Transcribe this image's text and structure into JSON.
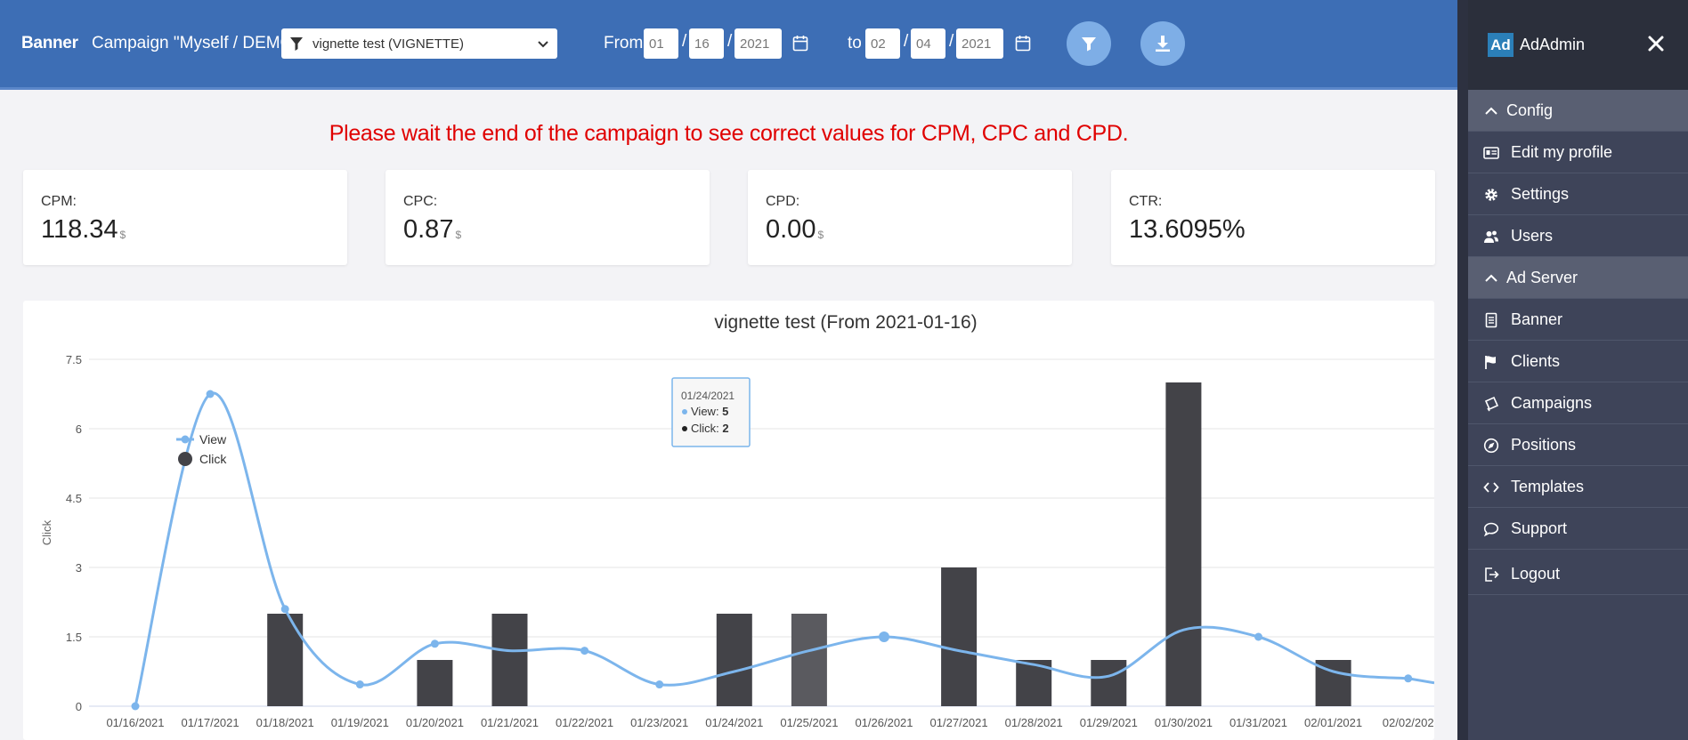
{
  "topbar": {
    "title": "Banner",
    "campaign_label": "Campaign \"Myself / DEMO\":",
    "campaign_value": "vignette test (VIGNETTE)",
    "from_label": "From",
    "from_month": "01",
    "from_day": "16",
    "from_year": "2021",
    "to_label": "to",
    "to_month": "02",
    "to_day": "04",
    "to_year": "2021",
    "date_separator": "/",
    "icons": [
      "filter-icon",
      "chevron-down-icon",
      "calendar-icon",
      "download-icon"
    ]
  },
  "notice": "Please wait the end of the campaign to see correct values for CPM, CPC and CPD.",
  "stats": [
    {
      "label": "CPM:",
      "value": "118.34",
      "unit": "$"
    },
    {
      "label": "CPC:",
      "value": "0.87",
      "unit": "$"
    },
    {
      "label": "CPD:",
      "value": "0.00",
      "unit": "$"
    },
    {
      "label": "CTR:",
      "value": "13.6095%",
      "unit": ""
    }
  ],
  "chart_data": {
    "type": "bar",
    "title": "vignette test (From 2021-01-16)",
    "xlabel": "",
    "ylabel": "Click",
    "ylim": [
      0,
      7.5
    ],
    "yticks": [
      "0",
      "1.5",
      "3",
      "4.5",
      "6",
      "7.5"
    ],
    "grid": true,
    "legend_position": "top-left",
    "categories": [
      "01/16/2021",
      "01/17/2021",
      "01/18/2021",
      "01/19/2021",
      "01/20/2021",
      "01/21/2021",
      "01/22/2021",
      "01/23/2021",
      "01/24/2021",
      "01/25/2021",
      "01/26/2021",
      "01/27/2021",
      "01/28/2021",
      "01/29/2021",
      "01/30/2021",
      "01/31/2021",
      "02/01/2021",
      "02/02/202"
    ],
    "series": [
      {
        "name": "View",
        "type": "spline",
        "color": "#7cb5ec",
        "values": [
          0,
          6.75,
          2.1,
          0.47,
          1.35,
          1.2,
          1.2,
          0.47,
          0.75,
          1.2,
          1.5,
          1.2,
          0.9,
          0.65,
          1.65,
          1.5,
          0.75,
          0.6
        ]
      },
      {
        "name": "Click",
        "type": "column",
        "color": "#434348",
        "values": [
          0,
          0,
          2,
          0,
          1,
          2,
          0,
          0,
          2,
          2,
          0,
          3,
          1,
          1,
          7,
          0,
          1,
          0
        ]
      }
    ],
    "tooltip": {
      "date": "01/24/2021",
      "view_label": "View",
      "view_value": "5",
      "click_label": "Click",
      "click_value": "2"
    }
  },
  "sidebar": {
    "logo": "Ad",
    "brand": "AdAdmin",
    "items": [
      {
        "label": "Config",
        "section": true,
        "icon": "chevron-up-icon"
      },
      {
        "label": "Edit my profile",
        "section": false,
        "icon": "id-card-icon"
      },
      {
        "label": "Settings",
        "section": false,
        "icon": "gear-icon"
      },
      {
        "label": "Users",
        "section": false,
        "icon": "users-icon"
      },
      {
        "label": "Ad Server",
        "section": true,
        "icon": "chevron-up-icon"
      },
      {
        "label": "Banner",
        "section": false,
        "icon": "document-icon"
      },
      {
        "label": "Clients",
        "section": false,
        "icon": "flag-icon"
      },
      {
        "label": "Campaigns",
        "section": false,
        "icon": "campaign-icon"
      },
      {
        "label": "Positions",
        "section": false,
        "icon": "compass-icon"
      },
      {
        "label": "Templates",
        "section": false,
        "icon": "code-icon"
      },
      {
        "label": "Support",
        "section": false,
        "icon": "chat-icon"
      },
      {
        "label": "Logout",
        "section": false,
        "icon": "logout-icon"
      }
    ]
  }
}
